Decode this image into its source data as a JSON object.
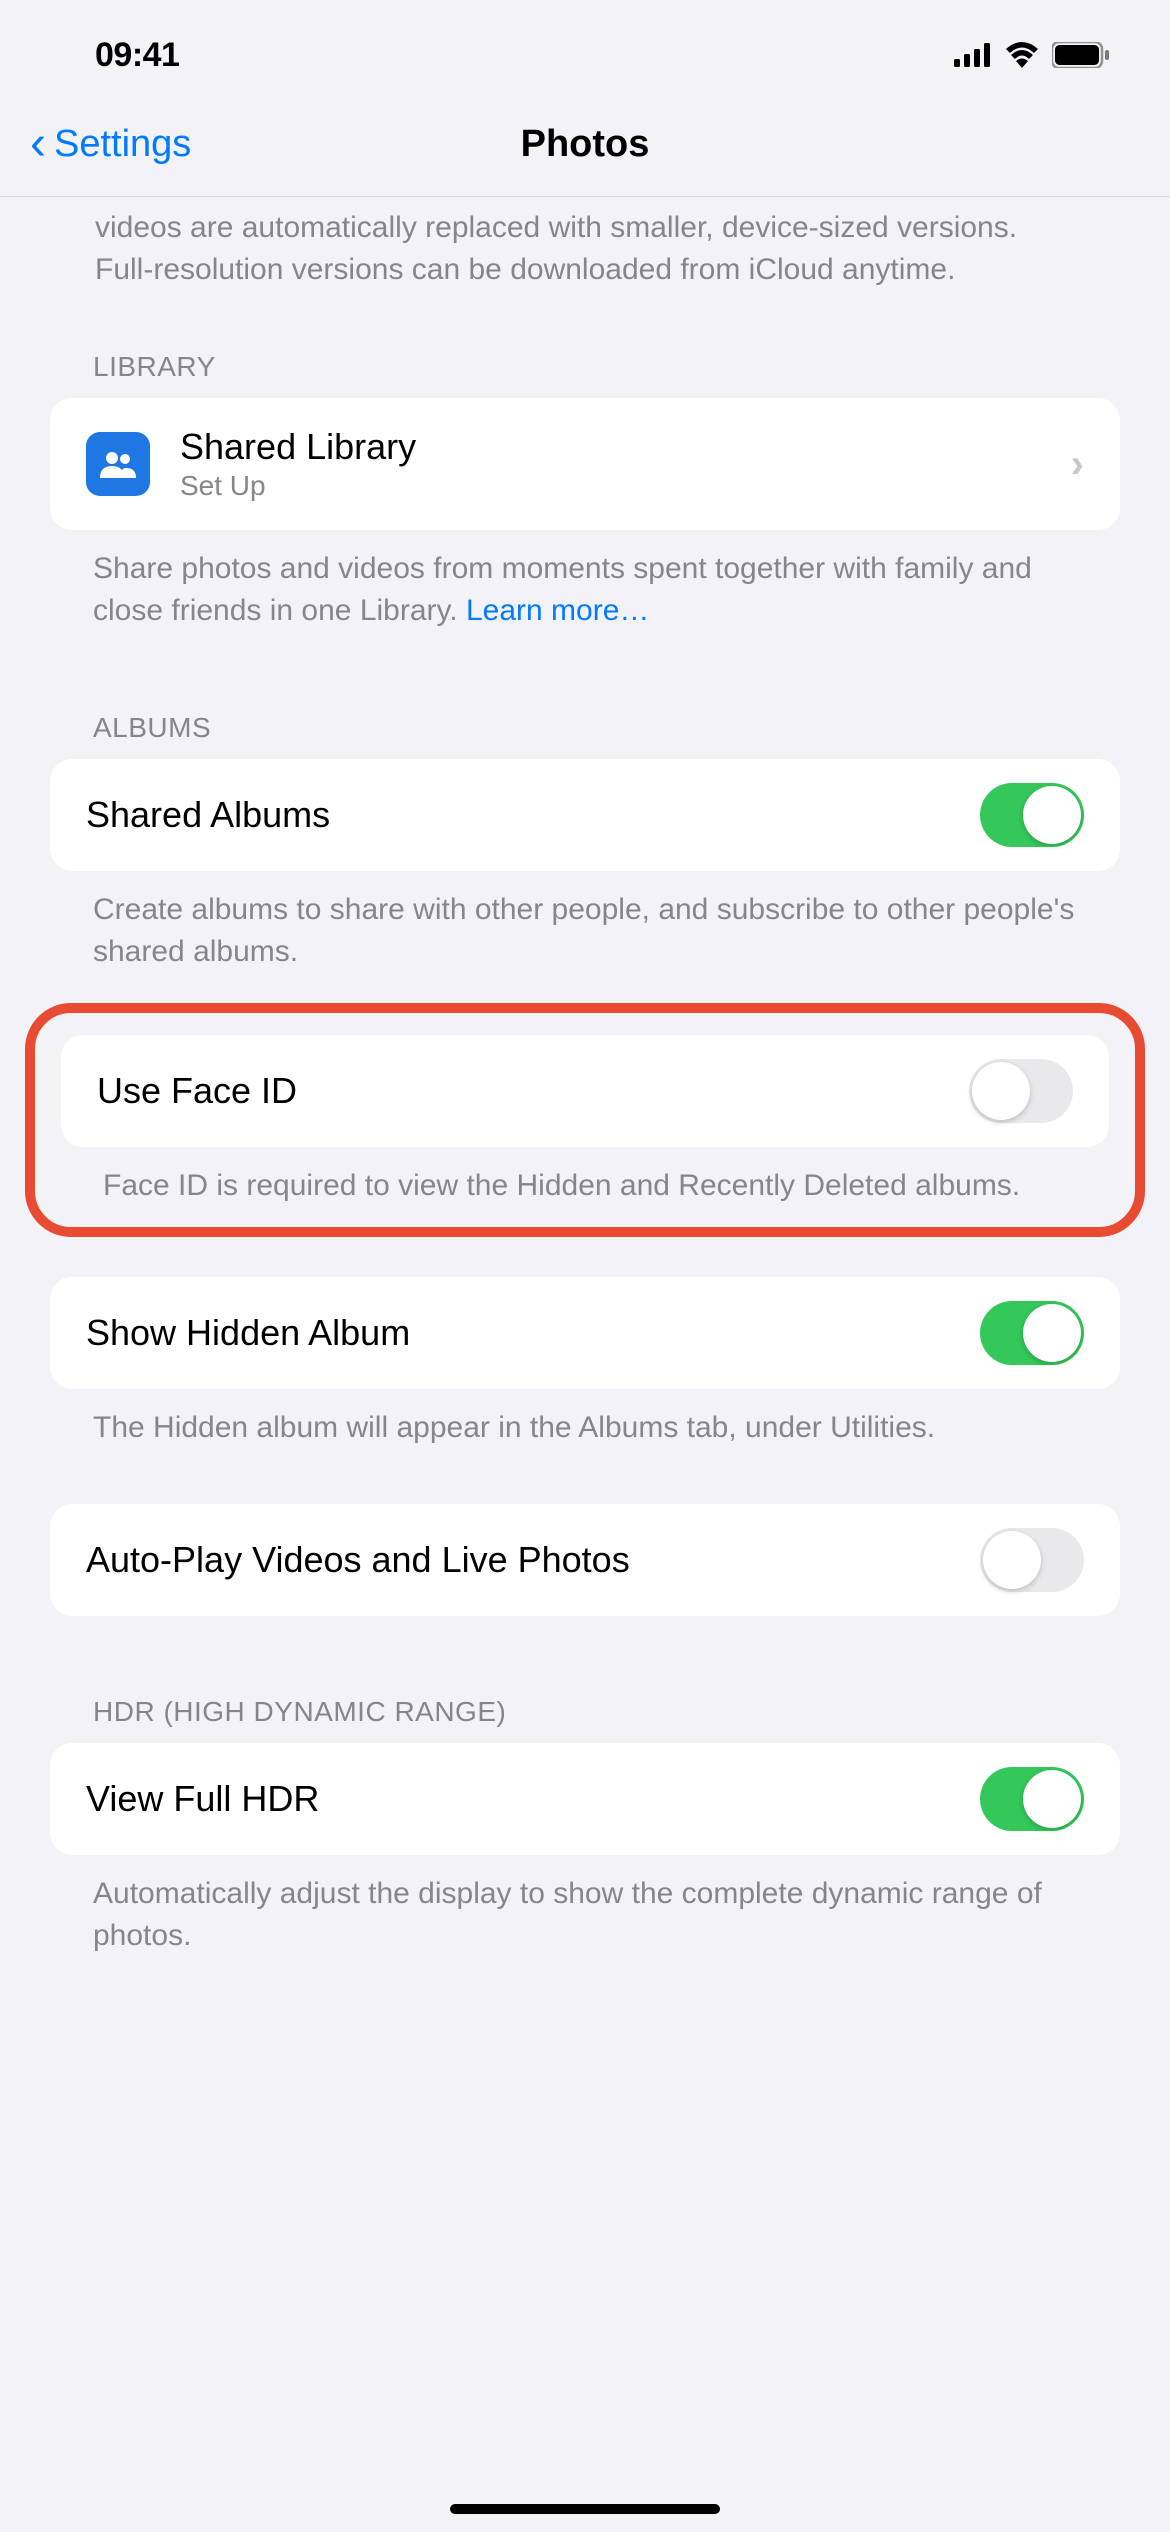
{
  "status": {
    "time": "09:41"
  },
  "nav": {
    "back_label": "Settings",
    "title": "Photos"
  },
  "intro": "videos are automatically replaced with smaller, device-sized versions. Full-resolution versions can be downloaded from iCloud anytime.",
  "library": {
    "header": "LIBRARY",
    "shared_library_title": "Shared Library",
    "shared_library_subtitle": "Set Up",
    "footer_text": "Share photos and videos from moments spent together with family and close friends in one Library. ",
    "learn_more": "Learn more…"
  },
  "albums": {
    "header": "ALBUMS",
    "shared_albums_label": "Shared Albums",
    "shared_albums_footer": "Create albums to share with other people, and subscribe to other people's shared albums.",
    "face_id_label": "Use Face ID",
    "face_id_footer": "Face ID is required to view the Hidden and Recently Deleted albums.",
    "show_hidden_label": "Show Hidden Album",
    "show_hidden_footer": "The Hidden album will appear in the Albums tab, under Utilities.",
    "autoplay_label": "Auto-Play Videos and Live Photos"
  },
  "hdr": {
    "header": "HDR (HIGH DYNAMIC RANGE)",
    "view_full_label": "View Full HDR",
    "view_full_footer": "Automatically adjust the display to show the complete dynamic range of photos."
  }
}
